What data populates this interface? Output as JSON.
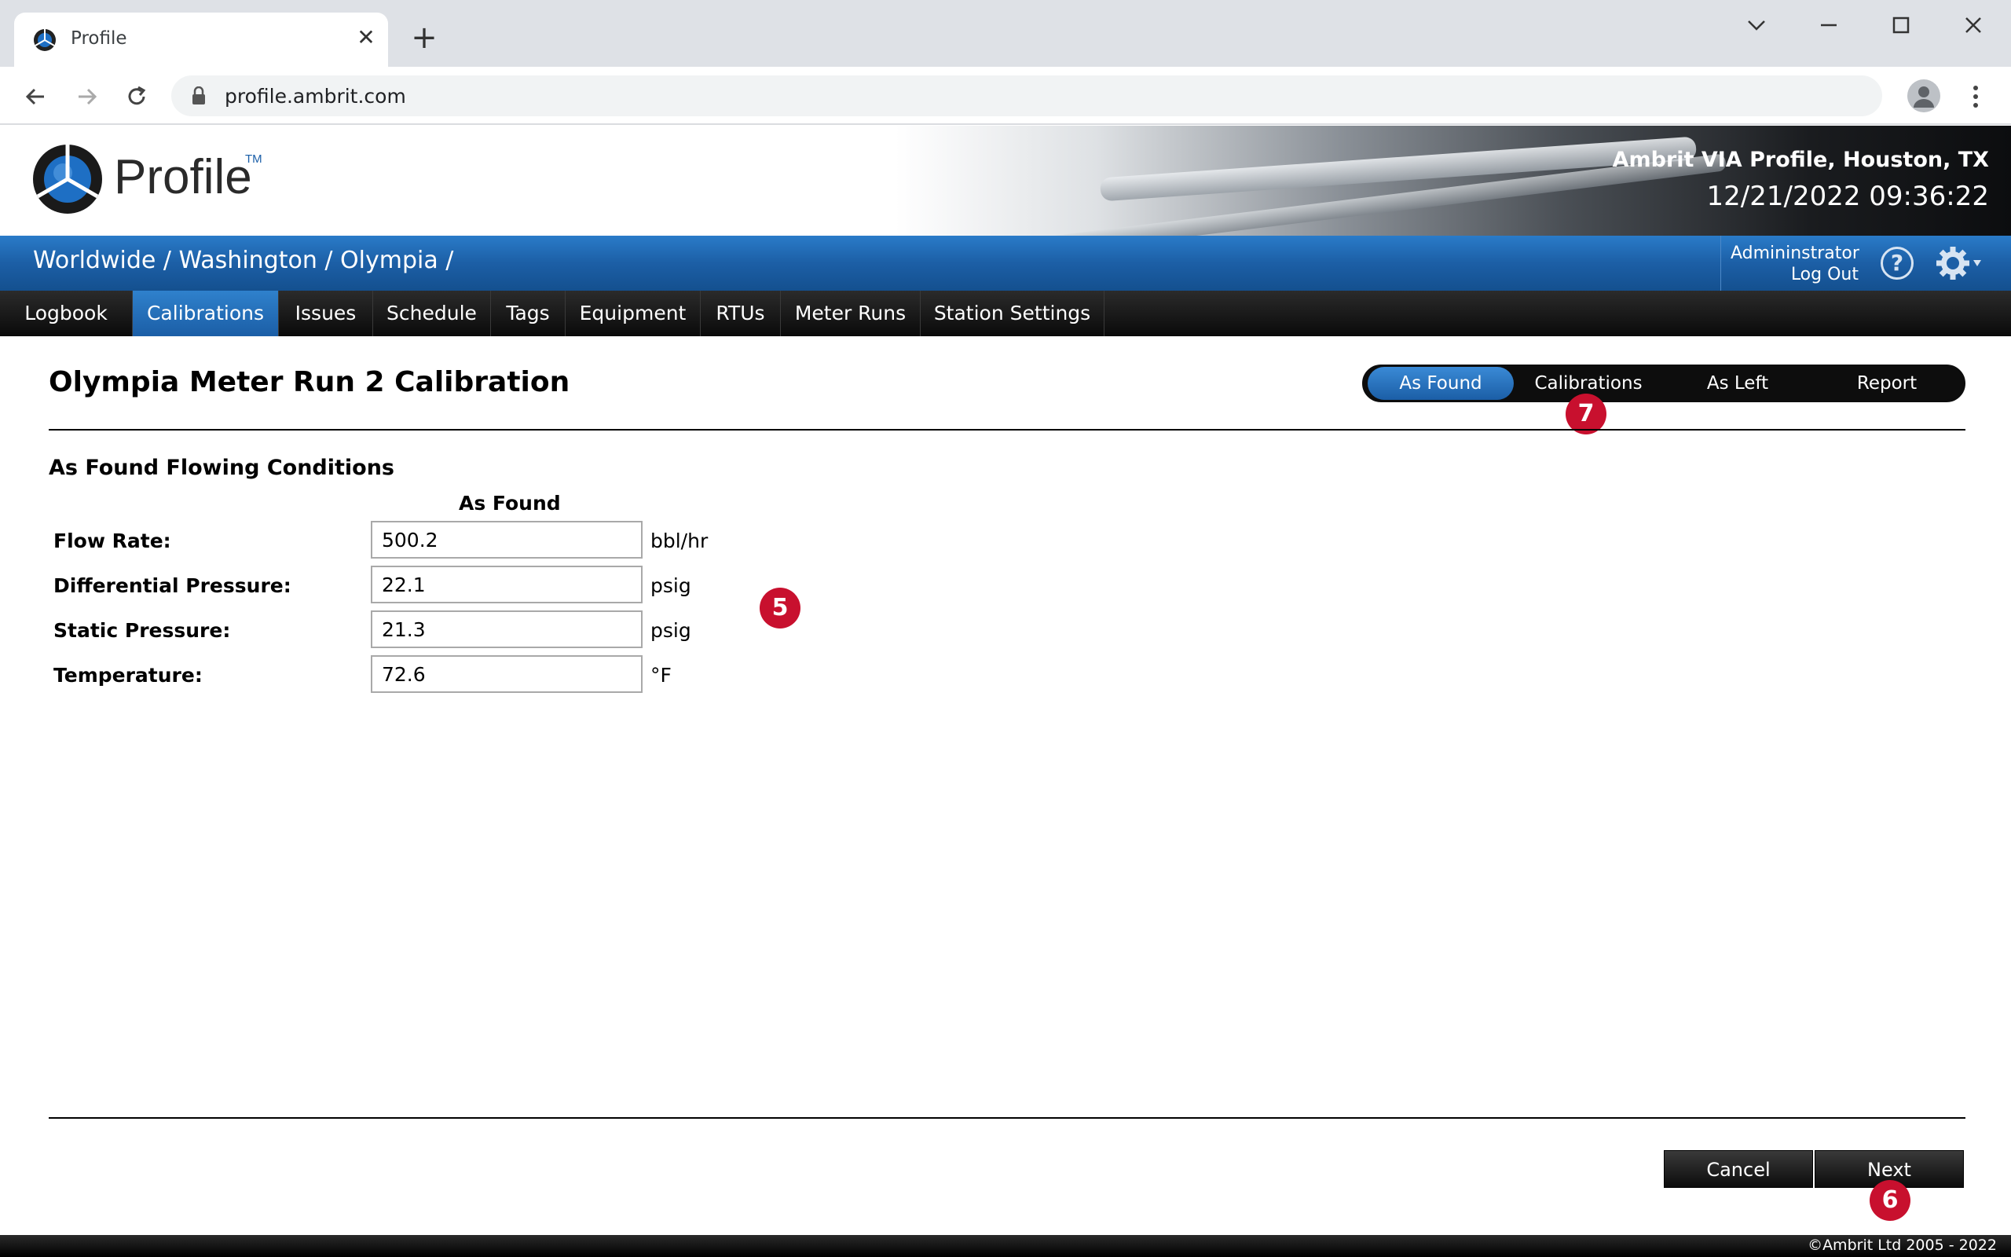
{
  "browser": {
    "tab_title": "Profile",
    "new_tab": "+",
    "url": "profile.ambrit.com"
  },
  "header": {
    "logo_text": "Profile",
    "logo_tm": "TM",
    "site_name": "Ambrit VIA Profile, Houston, TX",
    "datetime": "12/21/2022 09:36:22"
  },
  "breadcrumb": {
    "items": [
      "Worldwide",
      "Washington",
      "Olympia"
    ],
    "separator": "/"
  },
  "user": {
    "name": "Admininstrator",
    "logout": "Log Out",
    "help": "?"
  },
  "nav": {
    "items": [
      "Logbook",
      "Calibrations",
      "Issues",
      "Schedule",
      "Tags",
      "Equipment",
      "RTUs",
      "Meter Runs",
      "Station Settings"
    ],
    "active": "Calibrations"
  },
  "page": {
    "title": "Olympia Meter Run 2 Calibration",
    "section_title": "As Found Flowing Conditions",
    "column_header": "As Found"
  },
  "steps": {
    "items": [
      "As Found",
      "Calibrations",
      "As Left",
      "Report"
    ],
    "active": "As Found"
  },
  "fields": [
    {
      "label": "Flow Rate:",
      "value": "500.2",
      "unit": "bbl/hr"
    },
    {
      "label": "Differential Pressure:",
      "value": "22.1",
      "unit": "psig"
    },
    {
      "label": "Static Pressure:",
      "value": "21.3",
      "unit": "psig"
    },
    {
      "label": "Temperature:",
      "value": "72.6",
      "unit": "°F"
    }
  ],
  "markers": {
    "m5": "5",
    "m6": "6",
    "m7": "7",
    "color": "#c8102e"
  },
  "buttons": {
    "cancel": "Cancel",
    "next": "Next"
  },
  "footer": {
    "copyright": "©Ambrit Ltd 2005 - 2022"
  },
  "colors": {
    "accent_blue": "#1c5fa6",
    "nav_black": "#0a0a0a"
  }
}
